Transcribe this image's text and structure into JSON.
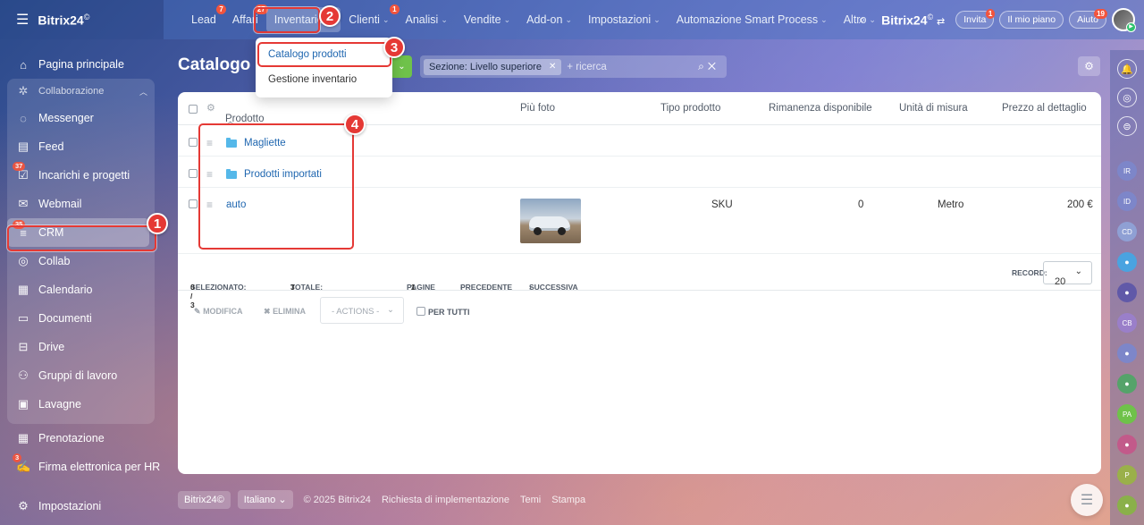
{
  "app": {
    "brand": "Bitrix24",
    "brand_mark": "©"
  },
  "topnav": {
    "items": [
      {
        "label": "Lead",
        "badge": "7",
        "chev": false
      },
      {
        "label": "Affari",
        "badge": "27",
        "chev": false
      },
      {
        "label": "Inventario",
        "badge": "",
        "chev": true
      },
      {
        "label": "Clienti",
        "badge": "1",
        "chev": true
      },
      {
        "label": "Analisi",
        "badge": "",
        "chev": true
      },
      {
        "label": "Vendite",
        "badge": "",
        "chev": true
      },
      {
        "label": "Add-on",
        "badge": "",
        "chev": true
      },
      {
        "label": "Impostazioni",
        "badge": "",
        "chev": true
      },
      {
        "label": "Automazione Smart Process",
        "badge": "",
        "chev": true
      },
      {
        "label": "Altro",
        "badge": "",
        "chev": true
      }
    ],
    "invite": {
      "label": "Invita",
      "badge": "1"
    },
    "plan": {
      "label": "Il mio piano"
    },
    "help": {
      "label": "Aiuto",
      "badge": "19"
    }
  },
  "sidebar": {
    "home": "Pagina principale",
    "collab_group": "Collaborazione",
    "group_items": [
      {
        "label": "Messenger",
        "icon": "messenger-icon",
        "badge": ""
      },
      {
        "label": "Feed",
        "icon": "feed-icon",
        "badge": ""
      },
      {
        "label": "Incarichi e progetti",
        "icon": "tasks-icon",
        "badge": "37"
      },
      {
        "label": "Webmail",
        "icon": "mail-icon",
        "badge": ""
      },
      {
        "label": "CRM",
        "icon": "crm-icon",
        "badge": "35"
      },
      {
        "label": "Collab",
        "icon": "collab-icon",
        "badge": ""
      },
      {
        "label": "Calendario",
        "icon": "calendar-icon",
        "badge": ""
      },
      {
        "label": "Documenti",
        "icon": "documents-icon",
        "badge": ""
      },
      {
        "label": "Drive",
        "icon": "drive-icon",
        "badge": ""
      },
      {
        "label": "Gruppi di lavoro",
        "icon": "groups-icon",
        "badge": ""
      },
      {
        "label": "Lavagne",
        "icon": "boards-icon",
        "badge": ""
      }
    ],
    "after": [
      {
        "label": "Prenotazione",
        "icon": "booking-icon",
        "badge": ""
      },
      {
        "label": "Firma elettronica per HR",
        "icon": "signature-icon",
        "badge": "3"
      }
    ],
    "settings": "Impostazioni"
  },
  "page": {
    "title": "Catalogo p",
    "filter_chip": "Sezione: Livello superiore",
    "filter_placeholder": "+ ricerca"
  },
  "dropdown": {
    "items": [
      "Catalogo prodotti",
      "Gestione inventario"
    ]
  },
  "table": {
    "columns": [
      "Prodotto",
      "Più foto",
      "Tipo prodotto",
      "Rimanenza disponibile",
      "Unità di misura",
      "Prezzo al dettaglio"
    ],
    "rows": [
      {
        "name": "Magliette",
        "folder": true,
        "type": "",
        "stock": "",
        "unit": "",
        "price": ""
      },
      {
        "name": "Prodotti importati",
        "folder": true,
        "type": "",
        "stock": "",
        "unit": "",
        "price": ""
      },
      {
        "name": "auto",
        "folder": false,
        "type": "SKU",
        "stock": "0",
        "unit": "Metro",
        "price": "200 €"
      }
    ]
  },
  "pager": {
    "selected_label": "SELEZIONATO:",
    "selected_value": "0 / 3",
    "total_label": "TOTALE:",
    "total_value": "3",
    "pages_label": "PAGINE",
    "pages_value": "1",
    "prev": "PRECEDENTE",
    "next": "SUCCESSIVA",
    "records_label": "RECORD:",
    "records_value": "20"
  },
  "actions": {
    "edit": "MODIFICA",
    "delete": "ELIMINA",
    "select": "- ACTIONS -",
    "for_all": "PER TUTTI"
  },
  "footer": {
    "brand": "Bitrix24©",
    "lang": "Italiano",
    "copyright": "© 2025 Bitrix24",
    "links": [
      "Richiesta di implementazione",
      "Temi",
      "Stampa"
    ]
  },
  "callouts": [
    "1",
    "2",
    "3",
    "4"
  ],
  "rail_labels": [
    "IR",
    "ID",
    "CD",
    "CB",
    "PA",
    "P"
  ],
  "colors": {
    "accent": "#2067b0",
    "highlight": "#e53935",
    "badge": "#f2543d",
    "green": "#6fc24a"
  }
}
